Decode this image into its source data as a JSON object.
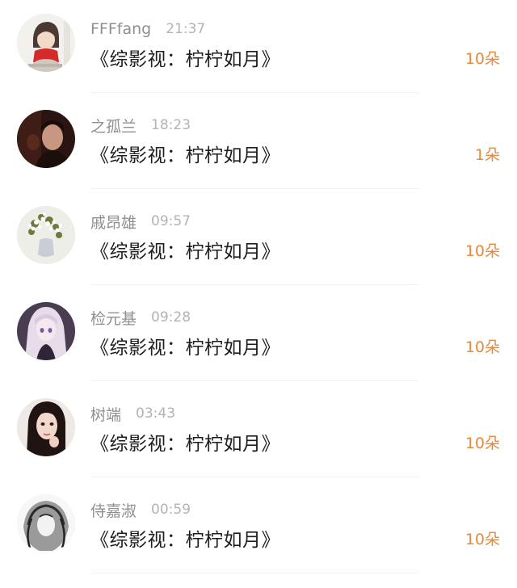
{
  "rows": [
    {
      "name": "FFFfang",
      "time": "21:37",
      "book": "《综影视：柠柠如月》",
      "gift": "10朵",
      "avatar": "avatar-girl-red-scarf"
    },
    {
      "name": "之孤兰",
      "time": "18:23",
      "book": "《综影视：柠柠如月》",
      "gift": "1朵",
      "avatar": "avatar-dark-photo"
    },
    {
      "name": "戚昂雄",
      "time": "09:57",
      "book": "《综影视：柠柠如月》",
      "gift": "10朵",
      "avatar": "avatar-white-flowers"
    },
    {
      "name": "检元基",
      "time": "09:28",
      "book": "《综影视：柠柠如月》",
      "gift": "10朵",
      "avatar": "avatar-anime-girl"
    },
    {
      "name": "树端",
      "time": "03:43",
      "book": "《综影视：柠柠如月》",
      "gift": "10朵",
      "avatar": "avatar-woman-photo"
    },
    {
      "name": "侍嘉淑",
      "time": "00:59",
      "book": "《综影视：柠柠如月》",
      "gift": "10朵",
      "avatar": "avatar-ink-sketch"
    }
  ],
  "colors": {
    "gift": "#e8893c",
    "name": "#8f8f8f",
    "time": "#b3b3b3",
    "book": "#1e1e1e"
  }
}
